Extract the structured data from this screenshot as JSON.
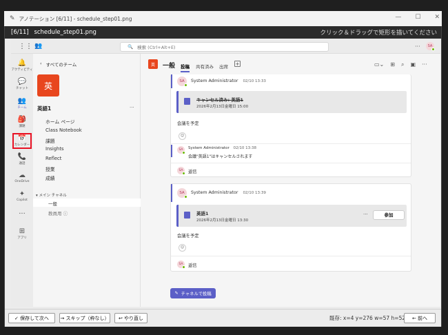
{
  "window": {
    "title": "アノテーション [6/11] - schedule_step01.png",
    "controls": [
      "—",
      "☐",
      "✕"
    ]
  },
  "banner": {
    "index": "[6/11]",
    "filename": "schedule_step01.png",
    "hint": "クリック＆ドラッグで矩形を描いてください"
  },
  "topbar": {
    "search_placeholder": "検索 (Ctrl+Alt+E)",
    "more": "···",
    "avatar": "SA"
  },
  "rail": {
    "items": [
      {
        "label": "アクティビティ",
        "icon": "bell"
      },
      {
        "label": "チャット",
        "icon": "chat"
      },
      {
        "label": "チーム",
        "icon": "teams"
      },
      {
        "label": "課題",
        "icon": "assignments"
      },
      {
        "label": "カレンダー",
        "icon": "calendar"
      },
      {
        "label": "通話",
        "icon": "phone"
      },
      {
        "label": "OneDrive",
        "icon": "cloud"
      },
      {
        "label": "Copilot",
        "icon": "copilot"
      },
      {
        "label": "···",
        "icon": "more"
      },
      {
        "label": "アプリ",
        "icon": "apps"
      }
    ]
  },
  "sidebar": {
    "back_label": "すべてのチーム",
    "team_initial": "英",
    "team_name": "英語1",
    "more": "···",
    "nav": [
      "ホーム ページ",
      "Class Notebook",
      "課題",
      "Insights",
      "Reflect",
      "授業",
      "成績"
    ],
    "section": "メイン チャネル",
    "channels": [
      "一般",
      "教員用"
    ]
  },
  "channel": {
    "tile": "英",
    "name": "一般",
    "tabs": [
      "投稿",
      "共有済み",
      "出席"
    ],
    "add": "+"
  },
  "posts": [
    {
      "avatar": "SA",
      "author": "System Administrator",
      "time": "02/10 13:33",
      "meeting_title": "キャンセル済み: 英語1",
      "meeting_time": "2026年2月13日金曜日 15:00",
      "body": "会議を予定",
      "reply": {
        "avatar": "SA",
        "author": "System Administrator",
        "time": "02/10 13:38",
        "text": "会議\"英語1\"はキャンセルされます"
      },
      "reply_label": "返信"
    },
    {
      "avatar": "SA",
      "author": "System Administrator",
      "time": "02/10 13:39",
      "meeting_title": "英語1",
      "meeting_time": "2026年2月13日金曜日 13:30",
      "more": "···",
      "join_label": "参加",
      "body": "会議を予定",
      "reply_label": "返信"
    }
  ],
  "post_button": "チャネルで投稿",
  "bottom": {
    "save_next": "✓ 保存して次へ",
    "skip": "→ スキップ（枠なし）",
    "redo": "↩ やり直し",
    "status": "既存: x=4 y=276 w=57 h=52",
    "prev": "← 前へ"
  },
  "colors": {
    "accent": "#5b5fc7",
    "team_tile": "#e8461e",
    "highlight": "#e81123"
  }
}
